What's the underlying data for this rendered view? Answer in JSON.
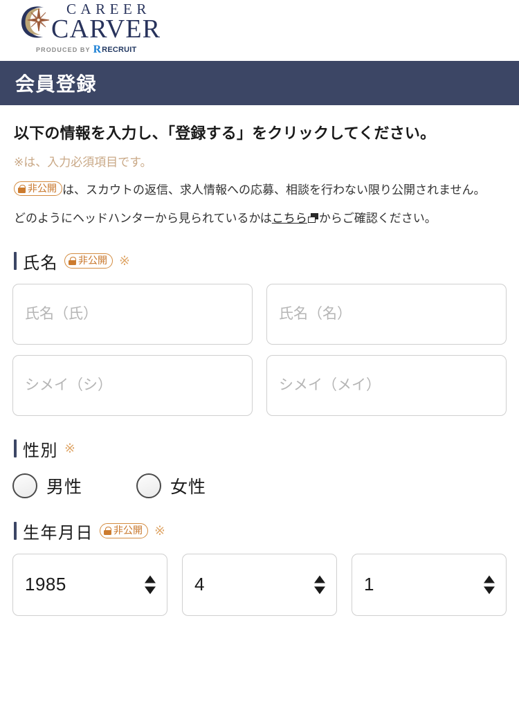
{
  "brand": {
    "name_line1": "CAREER",
    "name_line2": "CARVER",
    "produced_by": "PRODUCED BY",
    "recruit_mark": "R",
    "recruit_name": "RECRUIT"
  },
  "header": {
    "title": "会員登録"
  },
  "intro": {
    "lead": "以下の情報を入力し、「登録する」をクリックしてください。",
    "required_note": "※は、入力必須項目です。",
    "privacy_text_before": "は、スカウトの返信、求人情報への応募、相談を行わない限り公開されません。",
    "link_text_before": "どのようにヘッドハンターから見られているかは",
    "link_text": "こちら",
    "link_text_after": "からご確認ください。"
  },
  "badge": {
    "label": "非公開"
  },
  "required_symbol": "※",
  "sections": {
    "name": {
      "label": "氏名",
      "fields": [
        {
          "name": "last-name",
          "placeholder": "氏名（氏）",
          "value": ""
        },
        {
          "name": "first-name",
          "placeholder": "氏名（名）",
          "value": ""
        },
        {
          "name": "last-name-kana",
          "placeholder": "シメイ（シ）",
          "value": ""
        },
        {
          "name": "first-name-kana",
          "placeholder": "シメイ（メイ）",
          "value": ""
        }
      ]
    },
    "gender": {
      "label": "性別",
      "options": [
        {
          "label": "男性",
          "selected": false
        },
        {
          "label": "女性",
          "selected": false
        }
      ]
    },
    "birthdate": {
      "label": "生年月日",
      "selects": [
        {
          "name": "year",
          "value": "1985"
        },
        {
          "name": "month",
          "value": "4"
        },
        {
          "name": "day",
          "value": "1"
        }
      ]
    }
  },
  "colors": {
    "banner": "#3c4665",
    "accent_navy": "#3c4665",
    "accent_orange": "#c8762a",
    "required_tan": "#c9a886",
    "border_gray": "#cfcfcf"
  }
}
